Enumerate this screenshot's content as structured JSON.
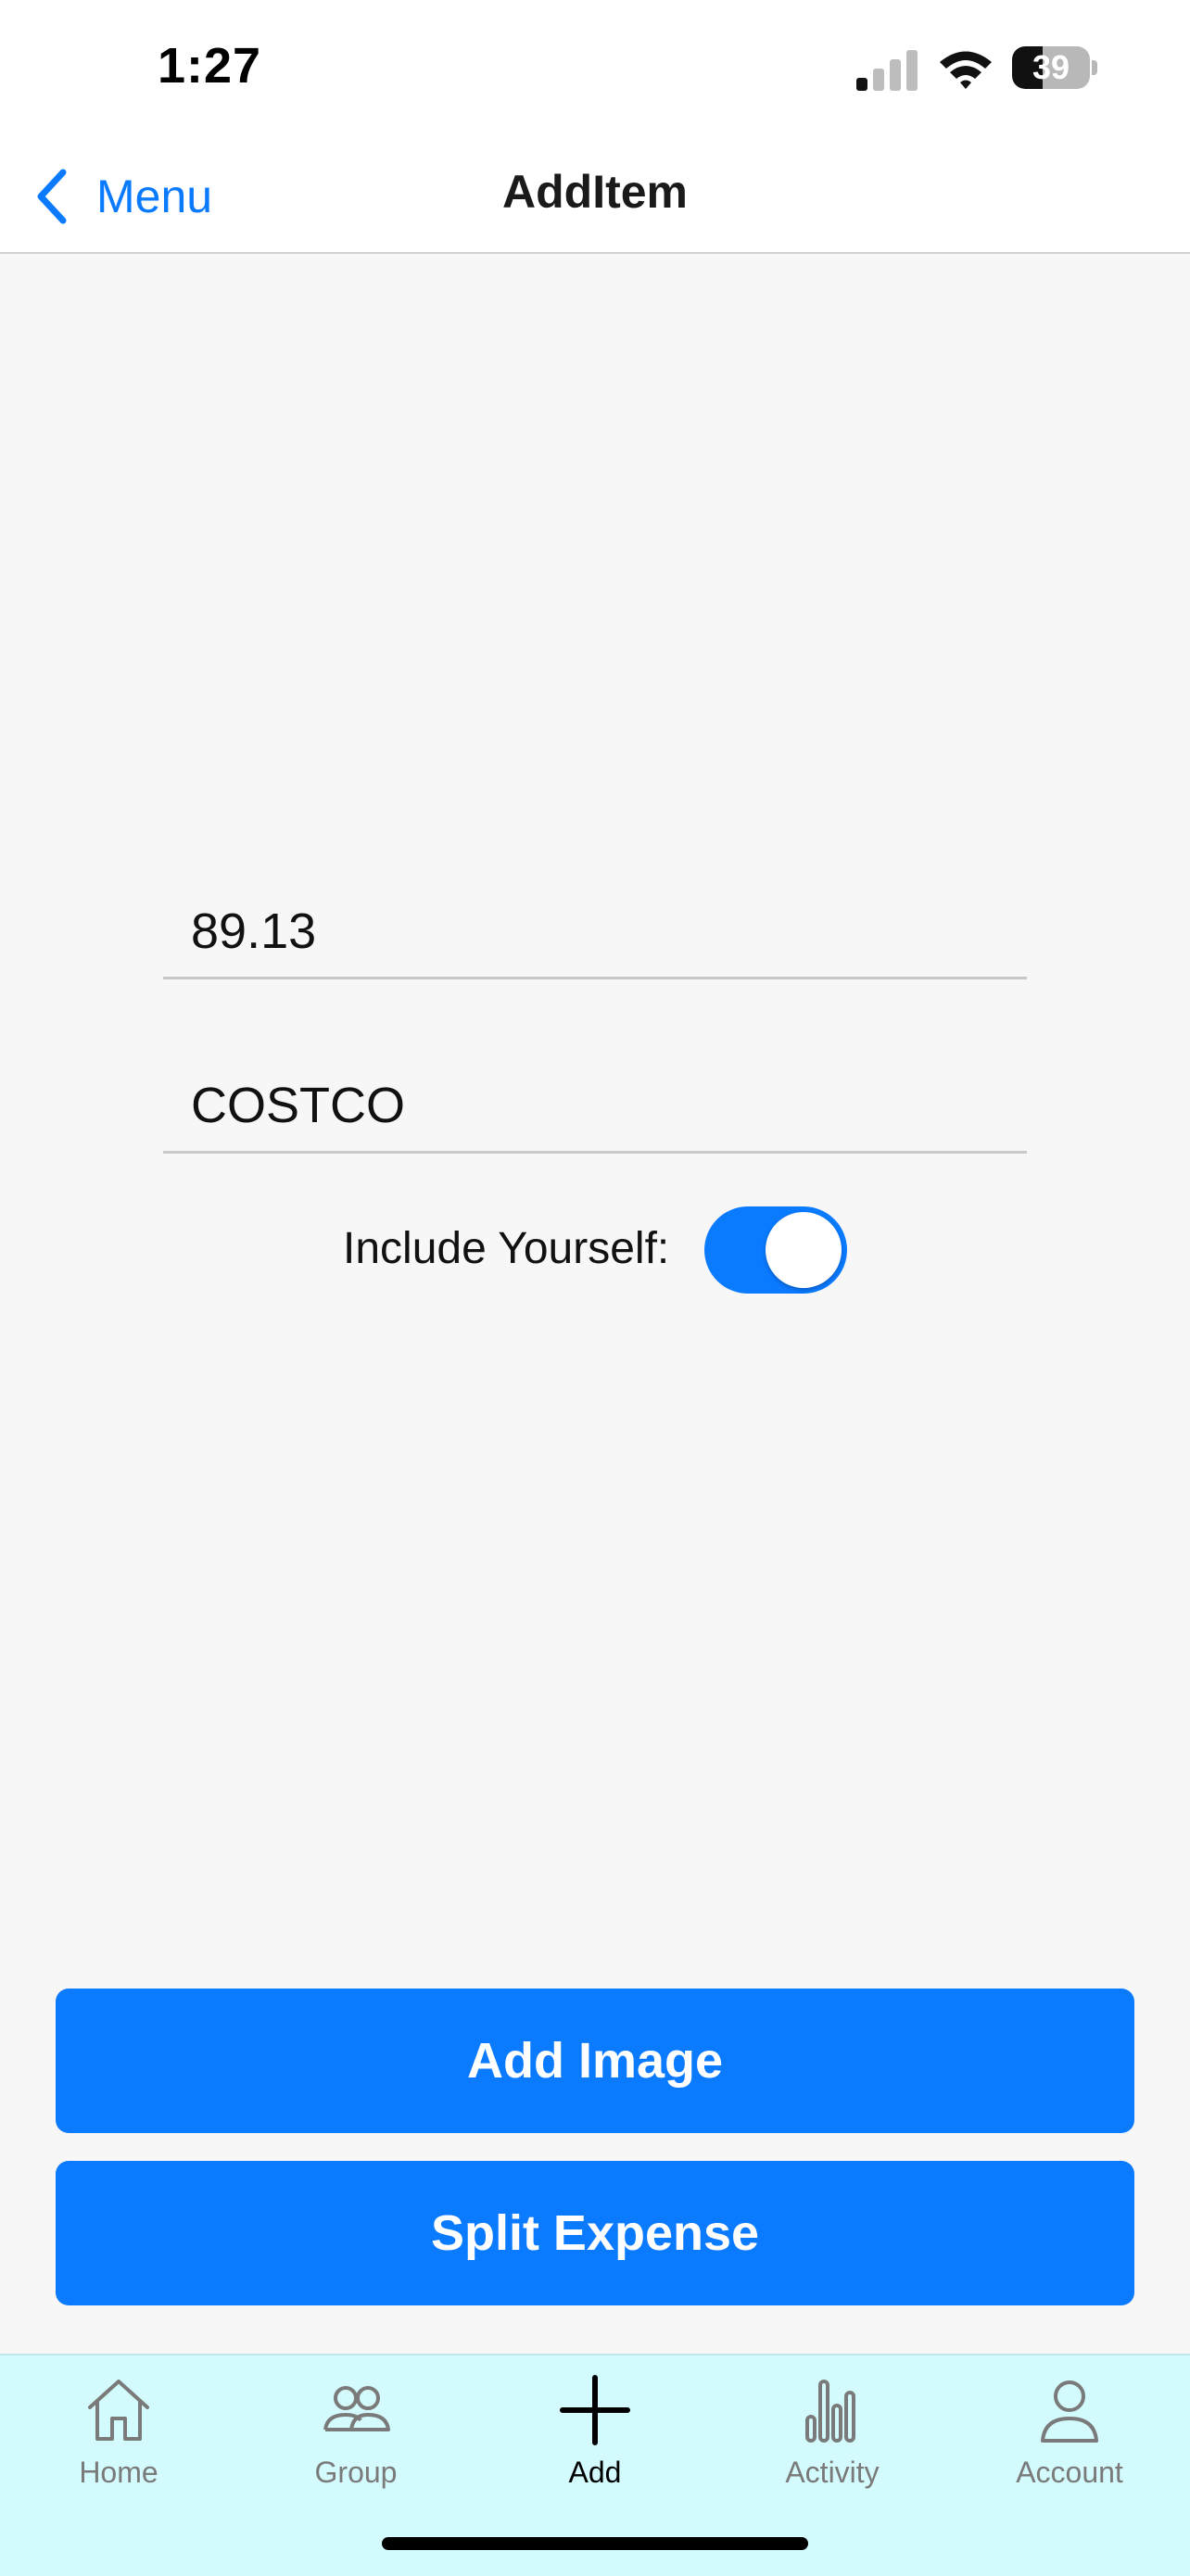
{
  "status_bar": {
    "time": "1:27",
    "battery_percent": "39",
    "battery_level": 0.39
  },
  "nav": {
    "back_label": "Menu",
    "title": "AddItem"
  },
  "form": {
    "amount_value": "89.13",
    "description_value": "COSTCO",
    "include_yourself_label": "Include Yourself:",
    "include_yourself_on": true
  },
  "buttons": {
    "add_image": "Add Image",
    "split_expense": "Split Expense"
  },
  "tab_bar": {
    "items": [
      {
        "label": "Home",
        "icon": "home-icon",
        "active": false
      },
      {
        "label": "Group",
        "icon": "group-icon",
        "active": false
      },
      {
        "label": "Add",
        "icon": "plus-icon",
        "active": true
      },
      {
        "label": "Activity",
        "icon": "chart-icon",
        "active": false
      },
      {
        "label": "Account",
        "icon": "person-icon",
        "active": false
      }
    ]
  },
  "colors": {
    "accent": "#0a7aff",
    "tab_bar_bg": "#d3fbfd",
    "background": "#f7f7f7"
  }
}
